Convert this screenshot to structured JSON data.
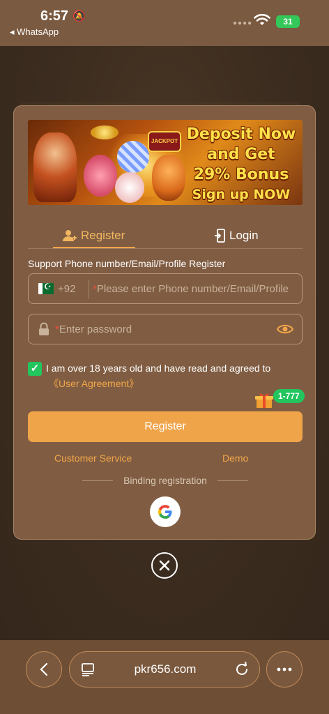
{
  "status": {
    "time": "6:57",
    "back_app": "◂ WhatsApp",
    "battery": "31"
  },
  "banner": {
    "line1": "Deposit Now",
    "line2": "and Get",
    "line3": "29% Bonus",
    "line4": "Sign up NOW",
    "jackpot": "JACKPOT"
  },
  "tabs": {
    "register": "Register",
    "login": "Login"
  },
  "form": {
    "support_label": "Support Phone number/Email/Profile Register",
    "country_code": "+92",
    "phone_placeholder": "Please enter Phone number/Email/Profile",
    "password_placeholder": "Enter password",
    "required_mark": "*",
    "agree_text": "I am over 18 years old and have read and agreed to",
    "agreement_link": "《User Agreement》",
    "badge": "1-777",
    "register_button": "Register",
    "customer_service": "Customer Service",
    "demo": "Demo",
    "binding": "Binding registration"
  },
  "browser": {
    "url": "pkr656.com"
  },
  "colors": {
    "accent": "#f0a44a",
    "modal_bg": "#805d42",
    "check_green": "#22c55e"
  }
}
